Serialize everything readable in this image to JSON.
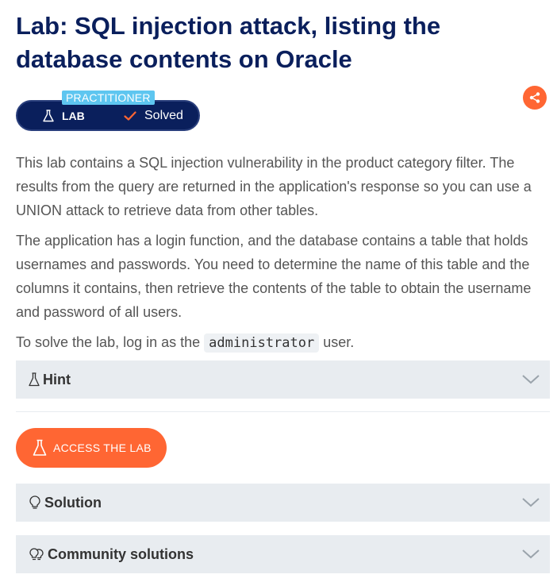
{
  "page": {
    "title": "Lab: SQL injection attack, listing the database contents on Oracle"
  },
  "badge": {
    "level": "PRACTITIONER",
    "lab_label": "LAB",
    "status": "Solved"
  },
  "description": {
    "p1": "This lab contains a SQL injection vulnerability in the product category filter. The results from the query are returned in the application's response so you can use a UNION attack to retrieve data from other tables.",
    "p2": "The application has a login function, and the database contains a table that holds usernames and passwords. You need to determine the name of this table and the columns it contains, then retrieve the contents of the table to obtain the username and password of all users.",
    "p3_before": "To solve the lab, log in as the",
    "p3_code": "administrator",
    "p3_after": "user."
  },
  "sections": {
    "hint": "Hint",
    "solution": "Solution",
    "community": "Community solutions"
  },
  "actions": {
    "access_lab": "ACCESS THE LAB"
  },
  "colors": {
    "title": "#0a1f5c",
    "pill_bg": "#0a1f5c",
    "level_tag": "#5ec6f0",
    "accent": "#ff6633",
    "accordion_bg": "#e8ecf0"
  },
  "icons": {
    "lab": "flask-icon",
    "solved": "check-icon",
    "share": "share-icon",
    "hint": "flask-icon",
    "solution": "lightbulb-icon",
    "community": "lightbulbs-icon",
    "expand": "chevron-down-icon"
  }
}
